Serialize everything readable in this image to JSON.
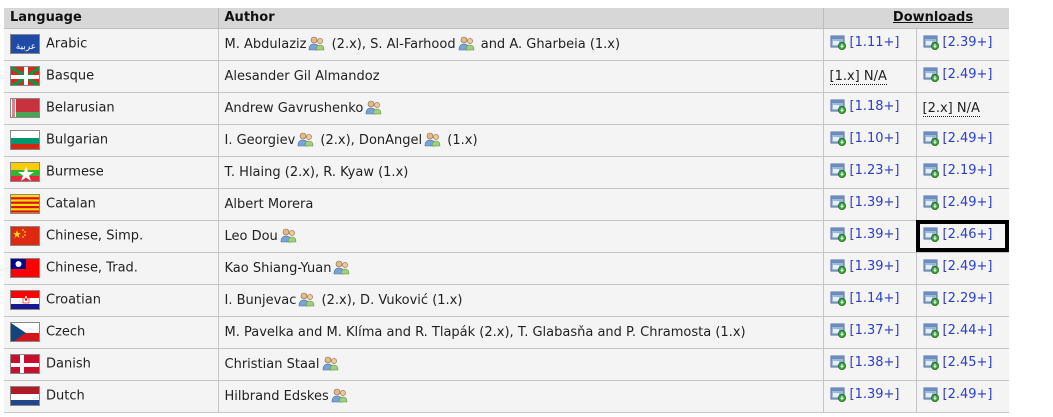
{
  "headers": {
    "language": "Language",
    "author": "Author",
    "downloads": "Downloads"
  },
  "rows": [
    {
      "language": "Arabic",
      "flag": "arabic",
      "author_parts": [
        {
          "t": "M. Abdulaziz",
          "icon": true
        },
        {
          "t": " (2.x), S. Al-Farhood",
          "icon": true
        },
        {
          "t": " and A. Gharbeia (1.x)",
          "icon": false
        }
      ],
      "dl1": {
        "label": "[1.11+]",
        "link": true
      },
      "dl2": {
        "label": "[2.39+]",
        "link": true
      }
    },
    {
      "language": "Basque",
      "flag": "basque",
      "author_parts": [
        {
          "t": "Alesander Gil Almandoz",
          "icon": false
        }
      ],
      "dl1": {
        "label": "[1.x] N/A",
        "link": false
      },
      "dl2": {
        "label": "[2.49+]",
        "link": true
      }
    },
    {
      "language": "Belarusian",
      "flag": "belarus",
      "author_parts": [
        {
          "t": "Andrew Gavrushenko",
          "icon": true
        }
      ],
      "dl1": {
        "label": "[1.18+]",
        "link": true
      },
      "dl2": {
        "label": "[2.x] N/A",
        "link": false
      }
    },
    {
      "language": "Bulgarian",
      "flag": "bulgaria",
      "author_parts": [
        {
          "t": "I. Georgiev",
          "icon": true
        },
        {
          "t": " (2.x), DonAngel",
          "icon": true
        },
        {
          "t": " (1.x)",
          "icon": false
        }
      ],
      "dl1": {
        "label": "[1.10+]",
        "link": true
      },
      "dl2": {
        "label": "[2.49+]",
        "link": true
      }
    },
    {
      "language": "Burmese",
      "flag": "burma",
      "author_parts": [
        {
          "t": "T. Hlaing (2.x), R. Kyaw (1.x)",
          "icon": false
        }
      ],
      "dl1": {
        "label": "[1.23+]",
        "link": true
      },
      "dl2": {
        "label": "[2.19+]",
        "link": true
      }
    },
    {
      "language": "Catalan",
      "flag": "catalan",
      "author_parts": [
        {
          "t": "Albert Morera",
          "icon": false
        }
      ],
      "dl1": {
        "label": "[1.39+]",
        "link": true
      },
      "dl2": {
        "label": "[2.49+]",
        "link": true
      }
    },
    {
      "language": "Chinese, Simp.",
      "flag": "china",
      "author_parts": [
        {
          "t": "Leo Dou",
          "icon": true
        }
      ],
      "dl1": {
        "label": "[1.39+]",
        "link": true
      },
      "dl2": {
        "label": "[2.46+]",
        "link": true,
        "highlight": true
      }
    },
    {
      "language": "Chinese, Trad.",
      "flag": "taiwan",
      "author_parts": [
        {
          "t": "Kao Shiang-Yuan",
          "icon": true
        }
      ],
      "dl1": {
        "label": "[1.39+]",
        "link": true
      },
      "dl2": {
        "label": "[2.49+]",
        "link": true
      }
    },
    {
      "language": "Croatian",
      "flag": "croatia",
      "author_parts": [
        {
          "t": "I. Bunjevac",
          "icon": true
        },
        {
          "t": " (2.x), D. Vuković (1.x)",
          "icon": false
        }
      ],
      "dl1": {
        "label": "[1.14+]",
        "link": true
      },
      "dl2": {
        "label": "[2.29+]",
        "link": true
      }
    },
    {
      "language": "Czech",
      "flag": "czech",
      "author_parts": [
        {
          "t": "M. Pavelka and M. Klíma and R. Tlapák (2.x), T. Glabasňa and P. Chramosta (1.x)",
          "icon": false
        }
      ],
      "dl1": {
        "label": "[1.37+]",
        "link": true
      },
      "dl2": {
        "label": "[2.44+]",
        "link": true
      }
    },
    {
      "language": "Danish",
      "flag": "denmark",
      "author_parts": [
        {
          "t": "Christian Staal",
          "icon": true
        }
      ],
      "dl1": {
        "label": "[1.38+]",
        "link": true
      },
      "dl2": {
        "label": "[2.45+]",
        "link": true
      }
    },
    {
      "language": "Dutch",
      "flag": "netherlands",
      "author_parts": [
        {
          "t": "Hilbrand Edskes",
          "icon": true
        }
      ],
      "dl1": {
        "label": "[1.39+]",
        "link": true
      },
      "dl2": {
        "label": "[2.49+]",
        "link": true
      }
    }
  ],
  "colors": {
    "link": "#2a3fc9",
    "header_bg": "#d7d7d7",
    "row_bg": "#f4f4f4"
  },
  "icons": {
    "author": "person-group-icon",
    "download": "package-download-icon"
  }
}
